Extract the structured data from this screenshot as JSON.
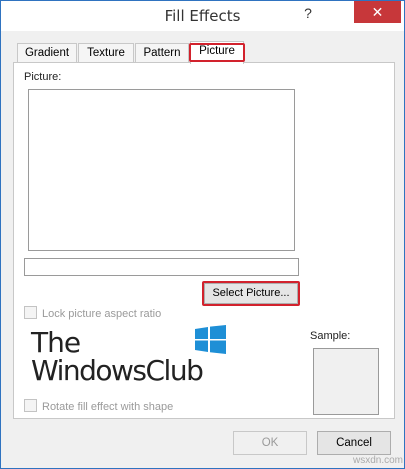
{
  "window": {
    "title": "Fill Effects",
    "help_label": "?",
    "close_label": "✕"
  },
  "tabs": [
    {
      "label": "Gradient"
    },
    {
      "label": "Texture"
    },
    {
      "label": "Pattern"
    },
    {
      "label": "Picture",
      "active": true
    }
  ],
  "panel": {
    "picture_label": "Picture:",
    "path_value": "",
    "select_button": "Select Picture...",
    "lock_label": "Lock picture aspect ratio",
    "rotate_label": "Rotate fill effect with shape",
    "sample_label": "Sample:"
  },
  "watermark": {
    "line1": "The",
    "line2": "WindowsClub",
    "icon": "windows-logo-icon"
  },
  "buttons": {
    "ok": "OK",
    "cancel": "Cancel"
  },
  "site_watermark": "wsxdn.com",
  "colors": {
    "close_bg": "#c7373a",
    "highlight": "#d2222d",
    "windows_blue": "#1e8fd6"
  }
}
